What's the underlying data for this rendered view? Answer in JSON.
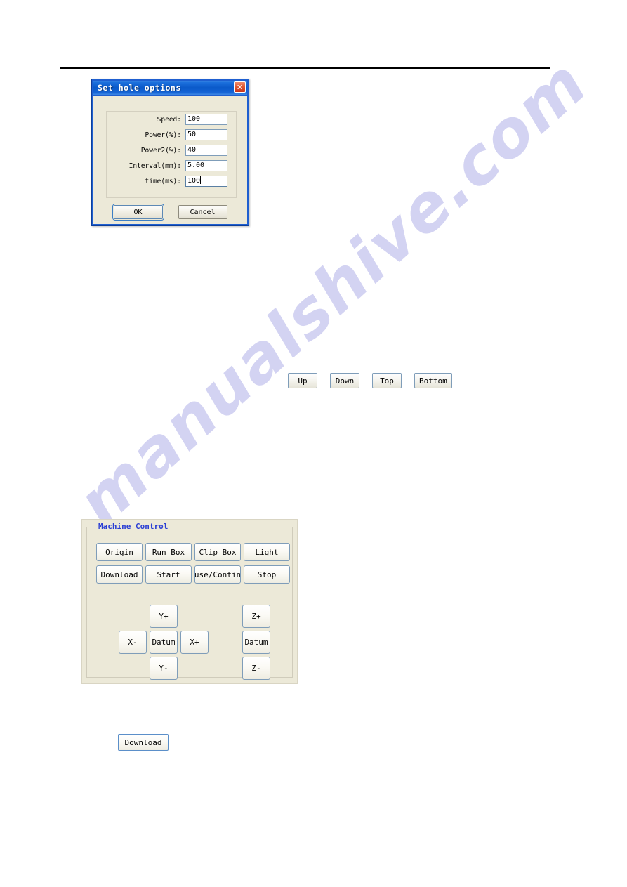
{
  "page": {
    "background_color": "#ffffff",
    "watermark_text": "manualshive.com",
    "watermark_color": "#ccccf0",
    "rule_color": "#000000"
  },
  "dialog": {
    "title": "Set hole options",
    "close_icon": "close-icon",
    "close_glyph": "✕",
    "titlebar_color": "#0a59c9",
    "close_color": "#e25b35",
    "body_color": "#ece9d8",
    "fields": [
      {
        "label": "Speed:",
        "value": "100",
        "focused": false
      },
      {
        "label": "Power(%):",
        "value": "50",
        "focused": false
      },
      {
        "label": "Power2(%):",
        "value": "40",
        "focused": false
      },
      {
        "label": "Interval(mm):",
        "value": "5.00",
        "focused": false
      },
      {
        "label": "time(ms):",
        "value": "100",
        "focused": true
      }
    ],
    "buttons": {
      "ok": "OK",
      "cancel": "Cancel"
    }
  },
  "nav_buttons": [
    {
      "label": "Up"
    },
    {
      "label": "Down"
    },
    {
      "label": "Top"
    },
    {
      "label": "Bottom"
    }
  ],
  "machine_control": {
    "legend": "Machine Control",
    "legend_color": "#2b3fd4",
    "panel_color": "#ece9d8",
    "command_buttons": [
      {
        "label": "Origin"
      },
      {
        "label": "Run Box"
      },
      {
        "label": "Clip Box"
      },
      {
        "label": "Light"
      },
      {
        "label": "Download"
      },
      {
        "label": "Start"
      },
      {
        "label": "use/Contin"
      },
      {
        "label": "Stop"
      }
    ],
    "jog_buttons": {
      "y_plus": "Y+",
      "x_minus": "X-",
      "datum_xy": "Datum",
      "x_plus": "X+",
      "y_minus": "Y-",
      "z_plus": "Z+",
      "datum_z": "Datum",
      "z_minus": "Z-"
    }
  },
  "standalone": {
    "download_label": "Download"
  }
}
